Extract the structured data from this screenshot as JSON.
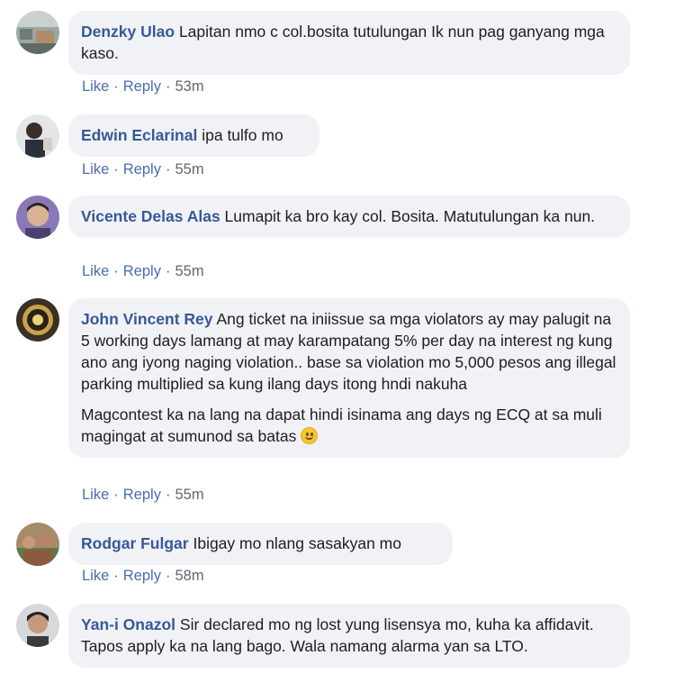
{
  "comments": [
    {
      "author": "Denzky Ulao",
      "text": "Lapitan nmo c col.bosita tutulungan Ik nun pag ganyang mga kaso.",
      "actions": {
        "like": "Like",
        "reply": "Reply",
        "time": "53m"
      }
    },
    {
      "author": "Edwin Eclarinal",
      "text": "ipa tulfo mo",
      "actions": {
        "like": "Like",
        "reply": "Reply",
        "time": "55m"
      }
    },
    {
      "author": "Vicente Delas Alas",
      "text": "Lumapit ka bro kay col. Bosita. Matutulungan ka nun.",
      "actions": {
        "like": "Like",
        "reply": "Reply",
        "time": "55m"
      }
    },
    {
      "author": "John Vincent Rey",
      "text": "Ang ticket na iniissue sa mga violators ay may palugit na 5 working days lamang at may karampatang 5% per day na interest ng kung ano ang iyong naging violation.. base sa violation mo 5,000 pesos ang illegal parking multiplied sa kung ilang days itong hndi nakuha",
      "text2": "Magcontest ka na lang na dapat hindi isinama ang days ng ECQ at sa muli magingat at sumunod sa batas",
      "emoji": "smiling-face-emoji",
      "actions": {
        "like": "Like",
        "reply": "Reply",
        "time": "55m"
      }
    },
    {
      "author": "Rodgar Fulgar",
      "text": "Ibigay mo nlang sasakyan mo",
      "actions": {
        "like": "Like",
        "reply": "Reply",
        "time": "58m"
      }
    },
    {
      "author": "Yan-i Onazol",
      "text": "Sir declared mo ng lost yung lisensya mo, kuha ka affidavit. Tapos apply ka na lang bago. Wala namang alarma yan sa LTO."
    }
  ],
  "separator": "·",
  "colors": {
    "author": "#385898",
    "bubble": "#f0f2f5",
    "action_link": "#4b6cb2",
    "meta": "#606770"
  }
}
